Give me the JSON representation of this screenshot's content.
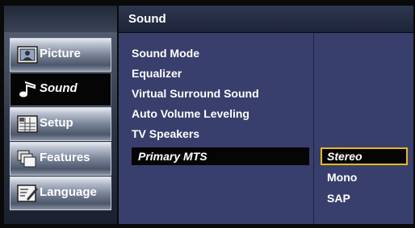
{
  "header": {
    "title": "Sound"
  },
  "sidebar": {
    "items": [
      {
        "label": "Picture",
        "icon": "picture-icon",
        "active": false
      },
      {
        "label": "Sound",
        "icon": "music-note-icon",
        "active": true
      },
      {
        "label": "Setup",
        "icon": "grid-icon",
        "active": false
      },
      {
        "label": "Features",
        "icon": "features-icon",
        "active": false
      },
      {
        "label": "Language",
        "icon": "language-icon",
        "active": false
      }
    ]
  },
  "menu": {
    "items": [
      {
        "label": "Sound Mode"
      },
      {
        "label": "Equalizer"
      },
      {
        "label": "Virtual Surround Sound"
      },
      {
        "label": "Auto Volume Leveling"
      },
      {
        "label": "TV Speakers"
      },
      {
        "label": "Primary MTS",
        "selected": true
      }
    ]
  },
  "options": {
    "items": [
      {
        "label": "Stereo",
        "selected": true
      },
      {
        "label": "Mono"
      },
      {
        "label": "SAP"
      }
    ]
  },
  "colors": {
    "panel": "#383f6c",
    "highlight_border": "#e8b820",
    "selected_bg": "#050505"
  }
}
